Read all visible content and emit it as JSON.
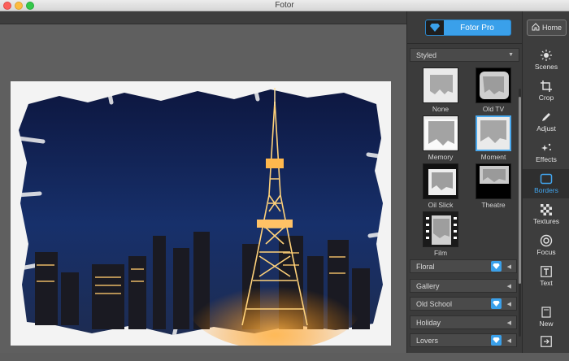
{
  "window": {
    "title": "Fotor"
  },
  "panel": {
    "pro_button": "Fotor Pro",
    "styled_section": "Styled",
    "thumbnails": [
      {
        "label": "None"
      },
      {
        "label": "Old TV"
      },
      {
        "label": "Memory"
      },
      {
        "label": "Moment"
      },
      {
        "label": "Oil Slick"
      },
      {
        "label": "Theatre"
      },
      {
        "label": "Film"
      }
    ],
    "selected_thumbnail": "Moment",
    "sections": [
      {
        "label": "Floral",
        "pro": true
      },
      {
        "label": "Gallery",
        "pro": false
      },
      {
        "label": "Old School",
        "pro": true
      },
      {
        "label": "Holiday",
        "pro": false
      },
      {
        "label": "Lovers",
        "pro": true
      }
    ]
  },
  "toolbar": {
    "home": "Home",
    "tools": [
      {
        "label": "Scenes",
        "icon": "sun-icon"
      },
      {
        "label": "Crop",
        "icon": "crop-icon"
      },
      {
        "label": "Adjust",
        "icon": "pencil-icon"
      },
      {
        "label": "Effects",
        "icon": "sparkle-icon"
      },
      {
        "label": "Borders",
        "icon": "border-frame-icon"
      },
      {
        "label": "Textures",
        "icon": "checker-icon"
      },
      {
        "label": "Focus",
        "icon": "focus-icon"
      },
      {
        "label": "Text",
        "icon": "text-icon"
      },
      {
        "label": "New",
        "icon": "new-icon"
      }
    ],
    "active_tool": "Borders"
  },
  "colors": {
    "accent": "#3aa0ea",
    "panel": "#3b3b3b",
    "canvas": "#5f5f5f"
  }
}
